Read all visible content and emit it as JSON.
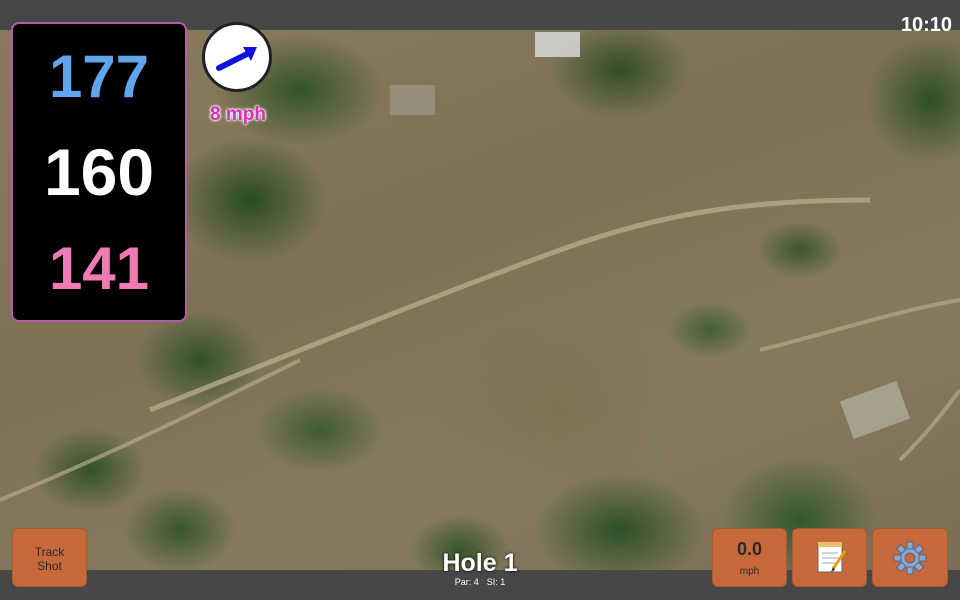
{
  "status": {
    "time": "10:10"
  },
  "yardage": {
    "back": "177",
    "middle": "160",
    "front": "141"
  },
  "wind": {
    "speed": "8 mph",
    "icon": "wind-direction-arrow-icon"
  },
  "hole": {
    "title": "Hole 1",
    "par": "Par: 4",
    "si": "SI: 1"
  },
  "buttons": {
    "track_shot_line1": "Track",
    "track_shot_line2": "Shot",
    "speed_value": "0.0",
    "speed_unit": "mph",
    "notes_icon": "notepad-icon",
    "settings_icon": "gear-icon"
  },
  "colors": {
    "back": "#5fa6ef",
    "middle": "#ffffff",
    "front": "#f07bb4",
    "accent": "#c8693b",
    "wind_text": "#d72fb8"
  }
}
